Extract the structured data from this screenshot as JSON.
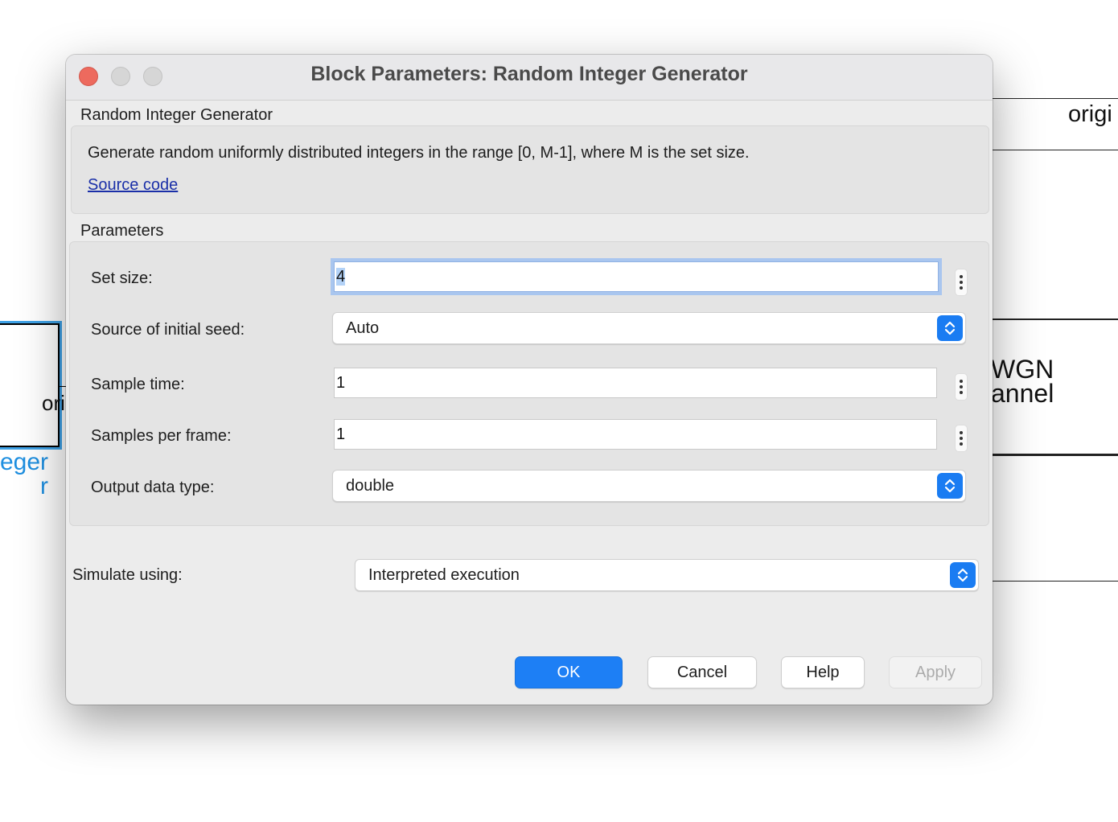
{
  "background": {
    "left_port_text": "ori",
    "left_block_label": "eger\nr",
    "right_port_text": "origi",
    "awgn_block_text": "WGN\nannel"
  },
  "dialog": {
    "title": "Block Parameters: Random Integer Generator",
    "block_name": "Random Integer Generator",
    "description": "Generate random uniformly distributed integers in the range [0, M-1], where M is the set size.",
    "source_code_link": "Source code",
    "parameters_label": "Parameters",
    "params": {
      "set_size": {
        "label": "Set size:",
        "value": "4"
      },
      "seed_source": {
        "label": "Source of initial seed:",
        "value": "Auto"
      },
      "sample_time": {
        "label": "Sample time:",
        "value": "1"
      },
      "samples_per_frame": {
        "label": "Samples per frame:",
        "value": "1"
      },
      "output_data_type": {
        "label": "Output data type:",
        "value": "double"
      }
    },
    "simulate_using": {
      "label": "Simulate using:",
      "value": "Interpreted execution"
    },
    "buttons": {
      "ok": "OK",
      "cancel": "Cancel",
      "help": "Help",
      "apply": "Apply"
    }
  },
  "colors": {
    "accent": "#1d7ff5",
    "close_button": "#ed6a5e",
    "link": "#1a2fa8",
    "selected_block": "#3ea1e6"
  },
  "icons": {
    "popup_arrows": "chevron-up-down-icon",
    "more_options": "vertical-ellipsis-icon"
  }
}
